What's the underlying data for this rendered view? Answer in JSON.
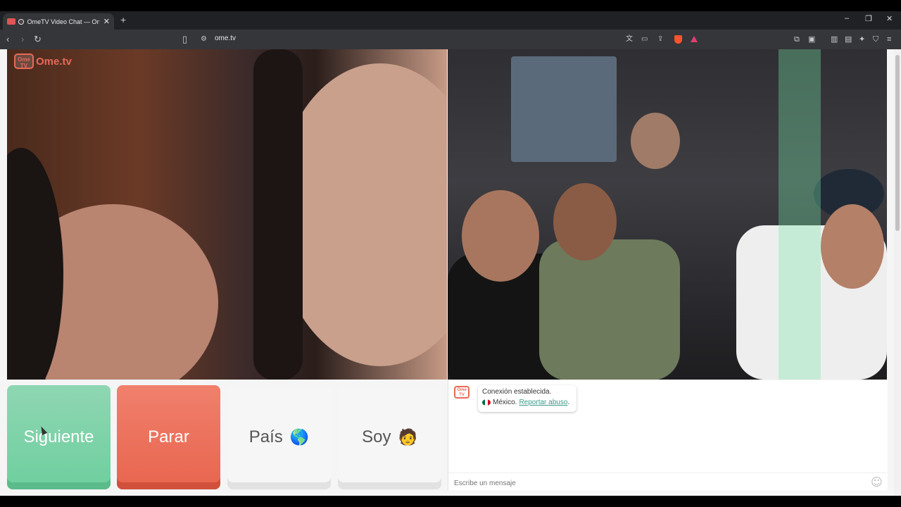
{
  "browser": {
    "tab_title": "OmeTV Video Chat — Omeg",
    "tab_close": "✕",
    "new_tab": "+",
    "url": "ome.tv",
    "window_controls": {
      "minimize": "–",
      "maximize": "❐",
      "close": "✕"
    },
    "icons": [
      "back-icon",
      "forward-icon",
      "reload-icon",
      "bookmark-icon",
      "site-info-icon",
      "translate-icon",
      "cast-icon",
      "share-icon",
      "brave-shield-icon",
      "brave-rewards-icon",
      "extensions-icon",
      "tab-search-icon",
      "sidebar-icon",
      "wallet-icon",
      "leo-ai-icon",
      "vpn-icon",
      "menu-icon"
    ]
  },
  "logo": {
    "box_text": "Ome TV",
    "text": "Ome.tv"
  },
  "buttons": {
    "next": "Siguiente",
    "stop": "Parar",
    "country": "País",
    "country_emoji": "🌎",
    "soy": "Soy",
    "soy_emoji": "🧑"
  },
  "chat": {
    "logo_text": "Ome TV",
    "status": "Conexión establecida.",
    "country": "México.",
    "report": "Reportar abuso",
    "report_suffix": ".",
    "placeholder": "Escribe un mensaje",
    "emoji_button": "☺"
  }
}
